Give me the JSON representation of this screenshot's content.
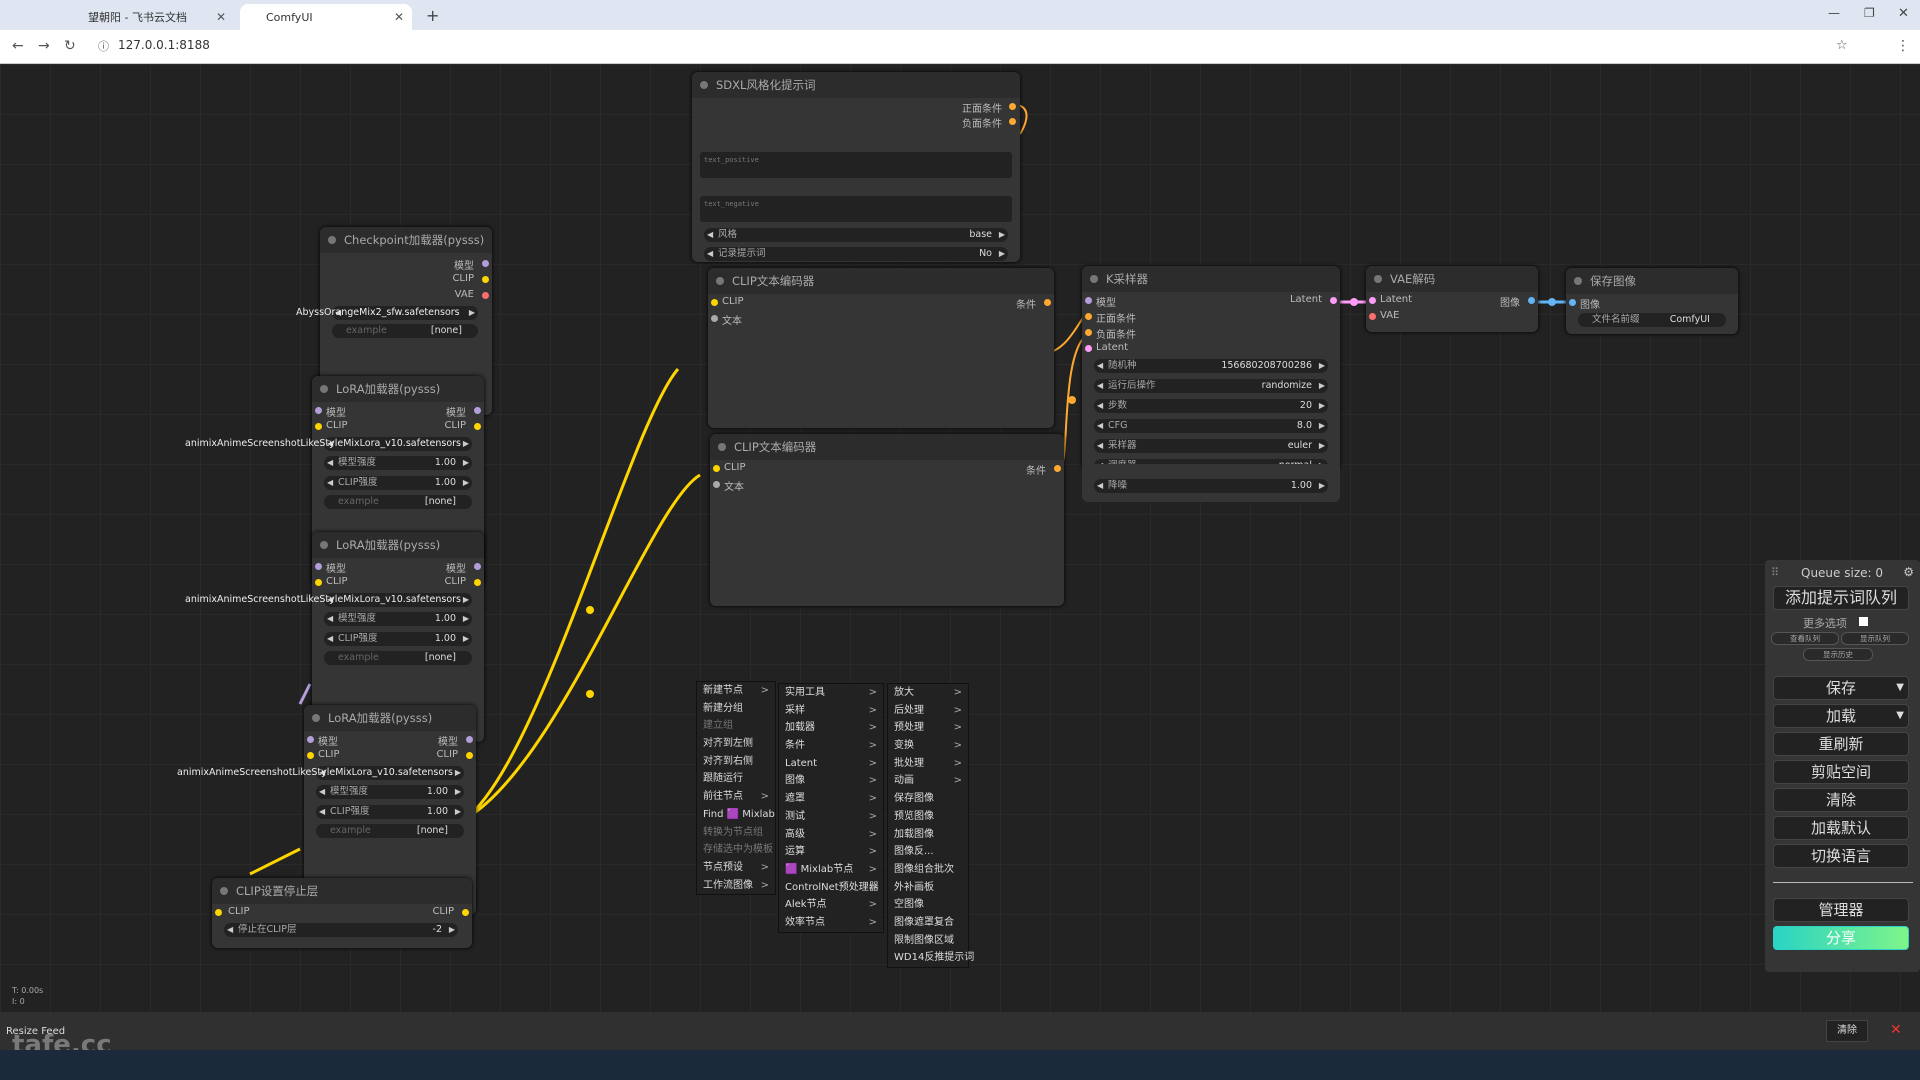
{
  "browser": {
    "tabs": [
      {
        "label": "望朝阳 - 飞书云文档"
      },
      {
        "label": "ComfyUI"
      }
    ],
    "url": "127.0.0.1:8188"
  },
  "nodes": {
    "sdxl": {
      "title": "SDXL风格化提示词",
      "out1": "正面条件",
      "out2": "负面条件",
      "ta1": "text_positive",
      "ta2": "text_negative",
      "w1_label": "风格",
      "w1_val": "base",
      "w2_label": "记录提示词",
      "w2_val": "No"
    },
    "checkpoint": {
      "title": "Checkpoint加载器(pysss)",
      "out_model": "模型",
      "out_clip": "CLIP",
      "out_vae": "VAE",
      "ckpt": "AbyssOrangeMix2_sfw.safetensors",
      "example": "example",
      "none": "[none]"
    },
    "lora1": {
      "title": "LoRA加载器(pysss)",
      "in_model": "模型",
      "in_clip": "CLIP",
      "out_model": "模型",
      "out_clip": "CLIP",
      "lora": "animixAnimeScreenshotLikeStyleMixLora_v10.safetensors",
      "w_model": "模型强度",
      "w_model_val": "1.00",
      "w_clip": "CLIP强度",
      "w_clip_val": "1.00",
      "example": "example",
      "none": "[none]"
    },
    "lora2": {
      "title": "LoRA加载器(pysss)",
      "in_model": "模型",
      "in_clip": "CLIP",
      "out_model": "模型",
      "out_clip": "CLIP",
      "lora": "animixAnimeScreenshotLikeStyleMixLora_v10.safetensors",
      "w_model": "模型强度",
      "w_model_val": "1.00",
      "w_clip": "CLIP强度",
      "w_clip_val": "1.00",
      "example": "example",
      "none": "[none]"
    },
    "lora3": {
      "title": "LoRA加载器(pysss)",
      "in_model": "模型",
      "in_clip": "CLIP",
      "out_model": "模型",
      "out_clip": "CLIP",
      "lora": "animixAnimeScreenshotLikeStyleMixLora_v10.safetensors",
      "w_model": "模型强度",
      "w_model_val": "1.00",
      "w_clip": "CLIP强度",
      "w_clip_val": "1.00",
      "example": "example",
      "none": "[none]"
    },
    "clipskip": {
      "title": "CLIP设置停止层",
      "in_clip": "CLIP",
      "out_clip": "CLIP",
      "w_label": "停止在CLIP层",
      "w_val": "-2"
    },
    "clipenc1": {
      "title": "CLIP文本编码器",
      "in_clip": "CLIP",
      "in_text": "文本",
      "out": "条件"
    },
    "clipenc2": {
      "title": "CLIP文本编码器",
      "in_clip": "CLIP",
      "in_text": "文本",
      "out": "条件"
    },
    "ksampler": {
      "title": "K采样器",
      "in_model": "模型",
      "in_pos": "正面条件",
      "in_neg": "负面条件",
      "in_latent": "Latent",
      "out": "Latent",
      "widgets": [
        {
          "l": "随机种",
          "v": "156680208700286"
        },
        {
          "l": "运行后操作",
          "v": "randomize"
        },
        {
          "l": "步数",
          "v": "20"
        },
        {
          "l": "CFG",
          "v": "8.0"
        },
        {
          "l": "采样器",
          "v": "euler"
        },
        {
          "l": "调度器",
          "v": "normal"
        },
        {
          "l": "降噪",
          "v": "1.00"
        }
      ]
    },
    "vae": {
      "title": "VAE解码",
      "in_latent": "Latent",
      "in_vae": "VAE",
      "out": "图像"
    },
    "save": {
      "title": "保存图像",
      "in_image": "图像",
      "w_label": "文件名前缀",
      "w_val": "ComfyUI"
    }
  },
  "menu1": [
    {
      "t": "新建节点",
      "s": true
    },
    {
      "t": "新建分组"
    },
    {
      "t": "建立组",
      "d": true
    },
    {
      "t": "对齐到左侧"
    },
    {
      "t": "对齐到右侧"
    },
    {
      "t": "跟随运行"
    },
    {
      "t": "前往节点",
      "s": true
    },
    {
      "t": "Find 🟪 Mixlab"
    },
    {
      "t": "转换为节点组",
      "d": true
    },
    {
      "t": "存储选中为模板",
      "d": true
    },
    {
      "t": "节点预设",
      "s": true
    },
    {
      "t": "工作流图像",
      "s": true
    }
  ],
  "menu2": [
    {
      "t": "实用工具",
      "s": true
    },
    {
      "t": "采样",
      "s": true
    },
    {
      "t": "加载器",
      "s": true
    },
    {
      "t": "条件",
      "s": true
    },
    {
      "t": "Latent",
      "s": true
    },
    {
      "t": "图像",
      "s": true
    },
    {
      "t": "遮罩",
      "s": true
    },
    {
      "t": "测试",
      "s": true
    },
    {
      "t": "高级",
      "s": true
    },
    {
      "t": "运算",
      "s": true
    },
    {
      "t": "🟪 Mixlab节点",
      "s": true
    },
    {
      "t": "ControlNet预处理器",
      "s": true
    },
    {
      "t": "Alek节点",
      "s": true
    },
    {
      "t": "效率节点",
      "s": true
    }
  ],
  "menu3": [
    {
      "t": "放大",
      "s": true
    },
    {
      "t": "后处理",
      "s": true
    },
    {
      "t": "预处理",
      "s": true
    },
    {
      "t": "变换",
      "s": true
    },
    {
      "t": "批处理",
      "s": true
    },
    {
      "t": "动画",
      "s": true
    },
    {
      "t": "保存图像"
    },
    {
      "t": "预览图像"
    },
    {
      "t": "加载图像"
    },
    {
      "t": "图像反..."
    },
    {
      "t": "图像组合批次"
    },
    {
      "t": "外补画板"
    },
    {
      "t": "空图像"
    },
    {
      "t": "图像遮罩复合"
    },
    {
      "t": "限制图像区域"
    },
    {
      "t": "WD14反推提示词"
    }
  ],
  "queue": {
    "size": "Queue size: 0",
    "add": "添加提示词队列",
    "more": "更多选项",
    "view_q": "查看队列",
    "view_h": "显示队列",
    "hist": "显示历史",
    "save": "保存",
    "load": "加载",
    "refresh": "重刷新",
    "clipspace": "剪贴空间",
    "clear": "清除",
    "loaddef": "加载默认",
    "lang": "切换语言",
    "manager": "管理器",
    "share": "分享"
  },
  "status": {
    "t": "T: 0.00s",
    "i": "I: 0",
    "resize": "Resize Feed",
    "clear": "清除",
    "watermark": "tafe.cc"
  },
  "colors": {
    "clip": "#ffd500",
    "model": "#b39ddb",
    "vae": "#ff6e6e",
    "cond": "#ffa931",
    "latent": "#ff9cf9",
    "image": "#64b5f6",
    "share": "#2ad3c4"
  }
}
